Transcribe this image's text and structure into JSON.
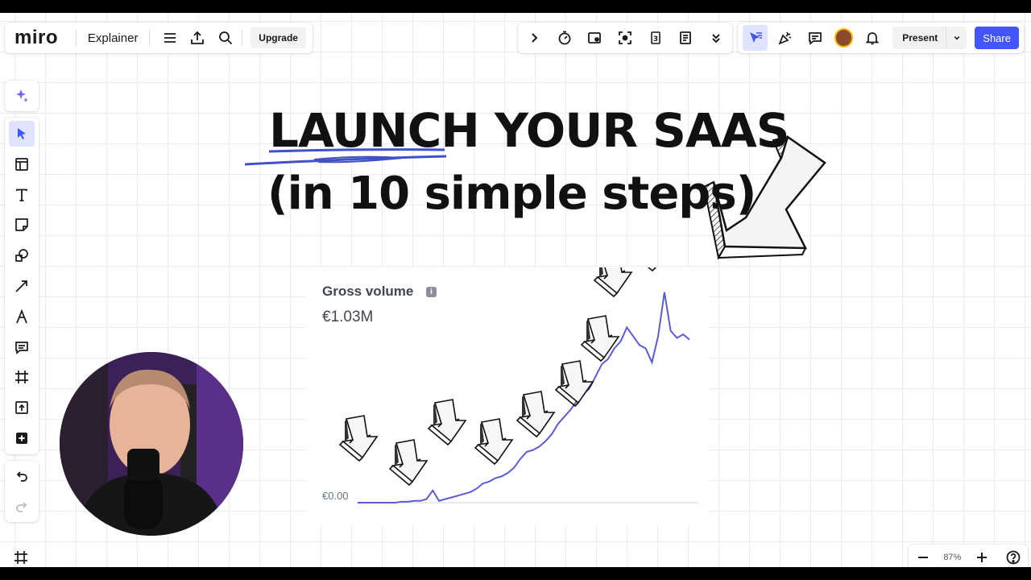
{
  "app": {
    "logo": "miro",
    "board_name": "Explainer",
    "upgrade_label": "Upgrade",
    "present_label": "Present",
    "share_label": "Share",
    "zoom_level": "87%"
  },
  "colors": {
    "accent": "#4255ff",
    "line": "#5b5bd6",
    "active_bg": "#dfe3ff"
  },
  "board": {
    "title_line1": "LAUNCH YOUR SAAS",
    "title_line2": "(in 10 simple steps)"
  },
  "chart": {
    "title": "Gross volume",
    "total": "€1.03M",
    "zero_label": "€0.00"
  },
  "chart_data": {
    "type": "line",
    "title": "Gross volume",
    "ylabel": "",
    "xlabel": "",
    "ylim": [
      0,
      1.0
    ],
    "y_tick_labels": [
      "€0.00"
    ],
    "series": [
      {
        "values": [
          0,
          0,
          0,
          0,
          0,
          0,
          0,
          0.005,
          0.005,
          0.01,
          0.01,
          0.02,
          0.07,
          0.01,
          0.02,
          0.03,
          0.04,
          0.05,
          0.06,
          0.08,
          0.11,
          0.12,
          0.14,
          0.15,
          0.17,
          0.2,
          0.25,
          0.29,
          0.3,
          0.32,
          0.35,
          0.39,
          0.45,
          0.49,
          0.53,
          0.58,
          0.62,
          0.65,
          0.72,
          0.79,
          0.82,
          0.88,
          0.92,
          1.0,
          0.95,
          0.9,
          0.88,
          0.8,
          0.95,
          1.2,
          0.98,
          0.94,
          0.96,
          0.93
        ]
      }
    ]
  }
}
